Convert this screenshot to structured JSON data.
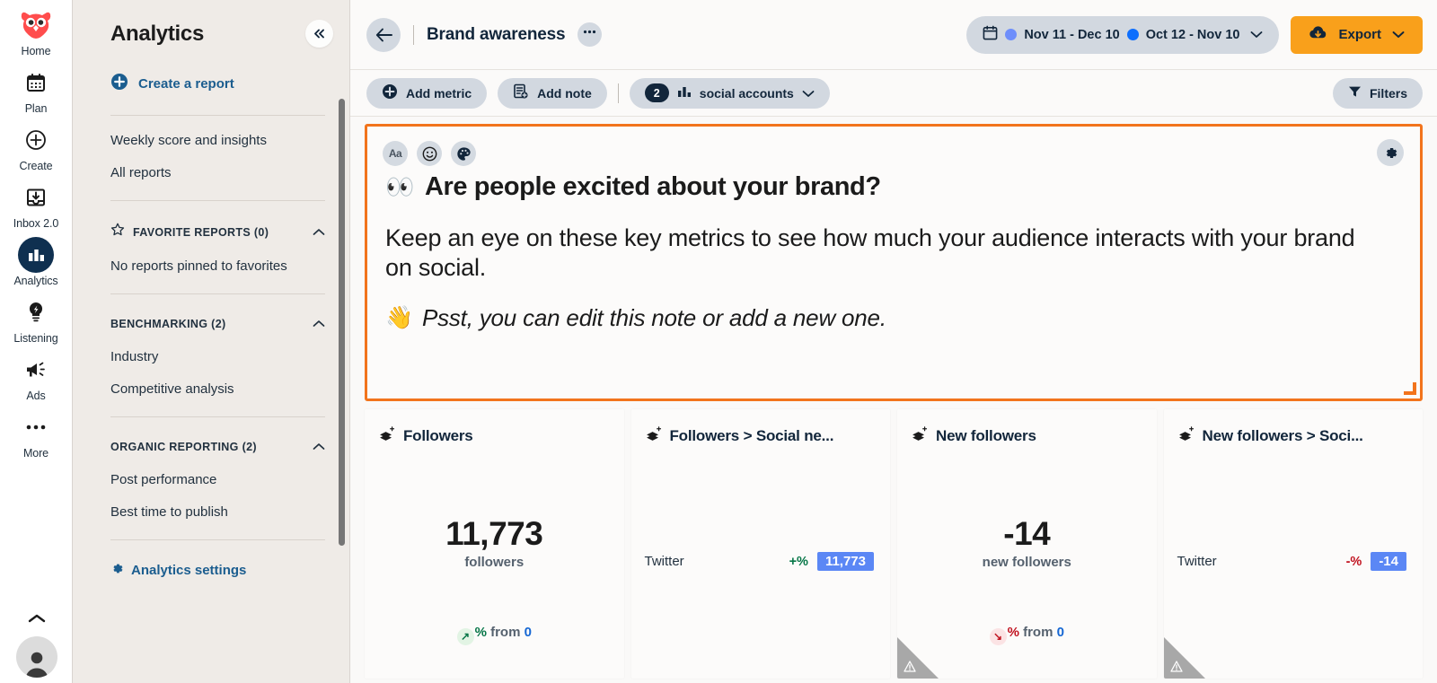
{
  "rail": {
    "items": [
      {
        "label": "Home",
        "icon": "owl-logo-icon",
        "active": false
      },
      {
        "label": "Plan",
        "icon": "calendar-icon",
        "active": false
      },
      {
        "label": "Create",
        "icon": "plus-circle-icon",
        "active": false
      },
      {
        "label": "Inbox 2.0",
        "icon": "inbox-icon",
        "active": false
      },
      {
        "label": "Analytics",
        "icon": "bar-chart-icon",
        "active": true
      },
      {
        "label": "Listening",
        "icon": "lightbulb-icon",
        "active": false
      },
      {
        "label": "Ads",
        "icon": "megaphone-icon",
        "active": false
      },
      {
        "label": "More",
        "icon": "ellipsis-icon",
        "active": false
      }
    ]
  },
  "panel": {
    "title": "Analytics",
    "collapse_icon": "double-chevron-left-icon",
    "create_report": "Create a report",
    "links": [
      "Weekly score and insights",
      "All reports"
    ],
    "sections": [
      {
        "title": "FAVORITE REPORTS (0)",
        "icon": "star-icon",
        "empty": "No reports pinned to favorites",
        "items": []
      },
      {
        "title": "BENCHMARKING (2)",
        "icon": "",
        "empty": "",
        "items": [
          "Industry",
          "Competitive analysis"
        ]
      },
      {
        "title": "ORGANIC REPORTING (2)",
        "icon": "",
        "empty": "",
        "items": [
          "Post performance",
          "Best time to publish"
        ]
      }
    ],
    "settings": "Analytics settings"
  },
  "topbar": {
    "back_icon": "arrow-left-icon",
    "report_title": "Brand awareness",
    "more_icon": "ellipsis-icon",
    "date_range": {
      "calendar_icon": "calendar-icon",
      "primary_dot_color": "#6e8efb",
      "primary_label": "Nov 11 - Dec 10",
      "compare_dot_color": "#0d6efd",
      "compare_label": "Oct 12 - Nov 10",
      "chevron_icon": "chevron-down-icon"
    },
    "export": {
      "label": "Export",
      "icon": "cloud-download-icon",
      "chevron_icon": "chevron-down-icon",
      "color": "#f9a01b"
    }
  },
  "toolbar": {
    "add_metric": {
      "label": "Add metric",
      "icon": "plus-circle-icon"
    },
    "add_note": {
      "label": "Add note",
      "icon": "note-add-icon"
    },
    "social_accounts": {
      "count": "2",
      "label": "social accounts",
      "icon": "bar-chart-icon",
      "chevron_icon": "chevron-down-icon"
    },
    "filters": {
      "label": "Filters",
      "icon": "funnel-icon"
    }
  },
  "note": {
    "border_color": "#f2741c",
    "tools": [
      {
        "name": "text-format",
        "glyph": "Aa"
      },
      {
        "name": "emoji",
        "glyph": "emoji-icon"
      },
      {
        "name": "color-palette",
        "glyph": "palette-icon"
      }
    ],
    "gear_icon": "gear-icon",
    "heading_emoji": "👀",
    "heading": "Are people excited about your brand?",
    "body": "Keep an eye on these key metrics to see how much your audience interacts with your brand on social.",
    "psst_emoji": "👋",
    "psst": "Psst, you can edit this note or add a new one.",
    "resize_handle": "resize-handle"
  },
  "cards": [
    {
      "title": "Followers",
      "icon": "metric-layers-icon",
      "type": "single",
      "value": "11,773",
      "unit": "followers",
      "delta_direction": "up",
      "delta_arrow": "↗",
      "delta_pct": "%",
      "delta_from_label": "from",
      "delta_from_value": "0",
      "warning": false
    },
    {
      "title": "Followers > Social ne...",
      "icon": "metric-layers-icon",
      "type": "breakdown",
      "network": "Twitter",
      "pct": "+%",
      "pct_direction": "up",
      "value": "11,773",
      "warning": false
    },
    {
      "title": "New followers",
      "icon": "metric-layers-icon",
      "type": "single",
      "value": "-14",
      "unit": "new followers",
      "delta_direction": "down",
      "delta_arrow": "↘",
      "delta_pct": "%",
      "delta_from_label": "from",
      "delta_from_value": "0",
      "warning": true
    },
    {
      "title": "New followers > Soci...",
      "icon": "metric-layers-icon",
      "type": "breakdown",
      "network": "Twitter",
      "pct": "-%",
      "pct_direction": "down",
      "value": "-14",
      "warning": true
    }
  ]
}
